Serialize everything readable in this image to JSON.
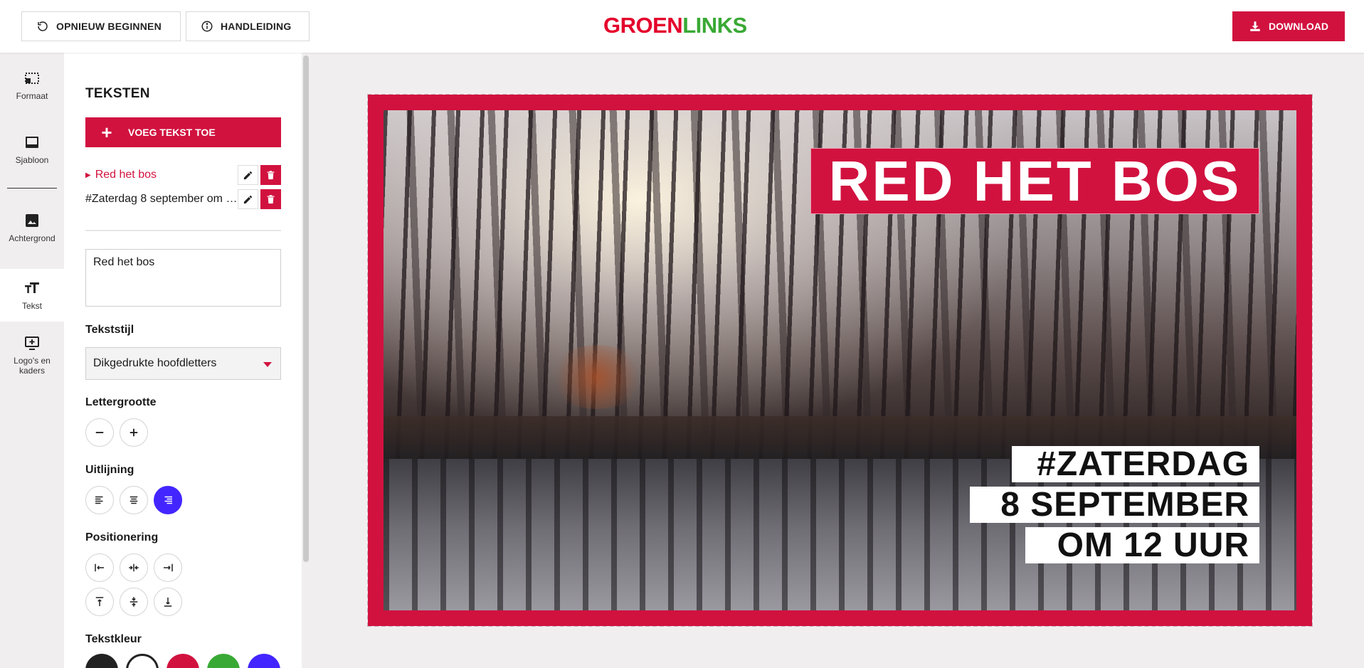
{
  "topbar": {
    "restart_label": "OPNIEUW BEGINNEN",
    "manual_label": "HANDLEIDING",
    "logo_part1": "GROEN",
    "logo_part2": "LINKS",
    "download_label": "DOWNLOAD"
  },
  "rail": {
    "items": [
      {
        "label": "Formaat",
        "icon": "format-icon"
      },
      {
        "label": "Sjabloon",
        "icon": "template-icon"
      },
      {
        "label": "Achtergrond",
        "icon": "image-icon"
      },
      {
        "label": "Tekst",
        "icon": "text-icon"
      },
      {
        "label": "Logo's en kaders",
        "icon": "add-frame-icon"
      }
    ]
  },
  "panel": {
    "title": "TEKSTEN",
    "add_button": "VOEG TEKST TOE",
    "texts": [
      {
        "label": "Red het bos"
      },
      {
        "label": "#Zaterdag 8 september om 12 uur"
      }
    ],
    "textarea_value": "Red het bos",
    "style_label": "Tekststijl",
    "style_value": "Dikgedrukte hoofdletters",
    "size_label": "Lettergrootte",
    "align_label": "Uitlijning",
    "position_label": "Positionering",
    "color_label": "Tekstkleur",
    "swatches": [
      "#222222",
      "#ffffff",
      "#d1123f",
      "#39a935",
      "#4326ff"
    ]
  },
  "canvas": {
    "headline": "RED HET BOS",
    "lines": [
      "#ZATERDAG",
      "8 SEPTEMBER",
      "OM 12 UUR"
    ]
  },
  "colors": {
    "accent_red": "#d1123f",
    "accent_green": "#39a935",
    "accent_purple": "#4326ff"
  }
}
